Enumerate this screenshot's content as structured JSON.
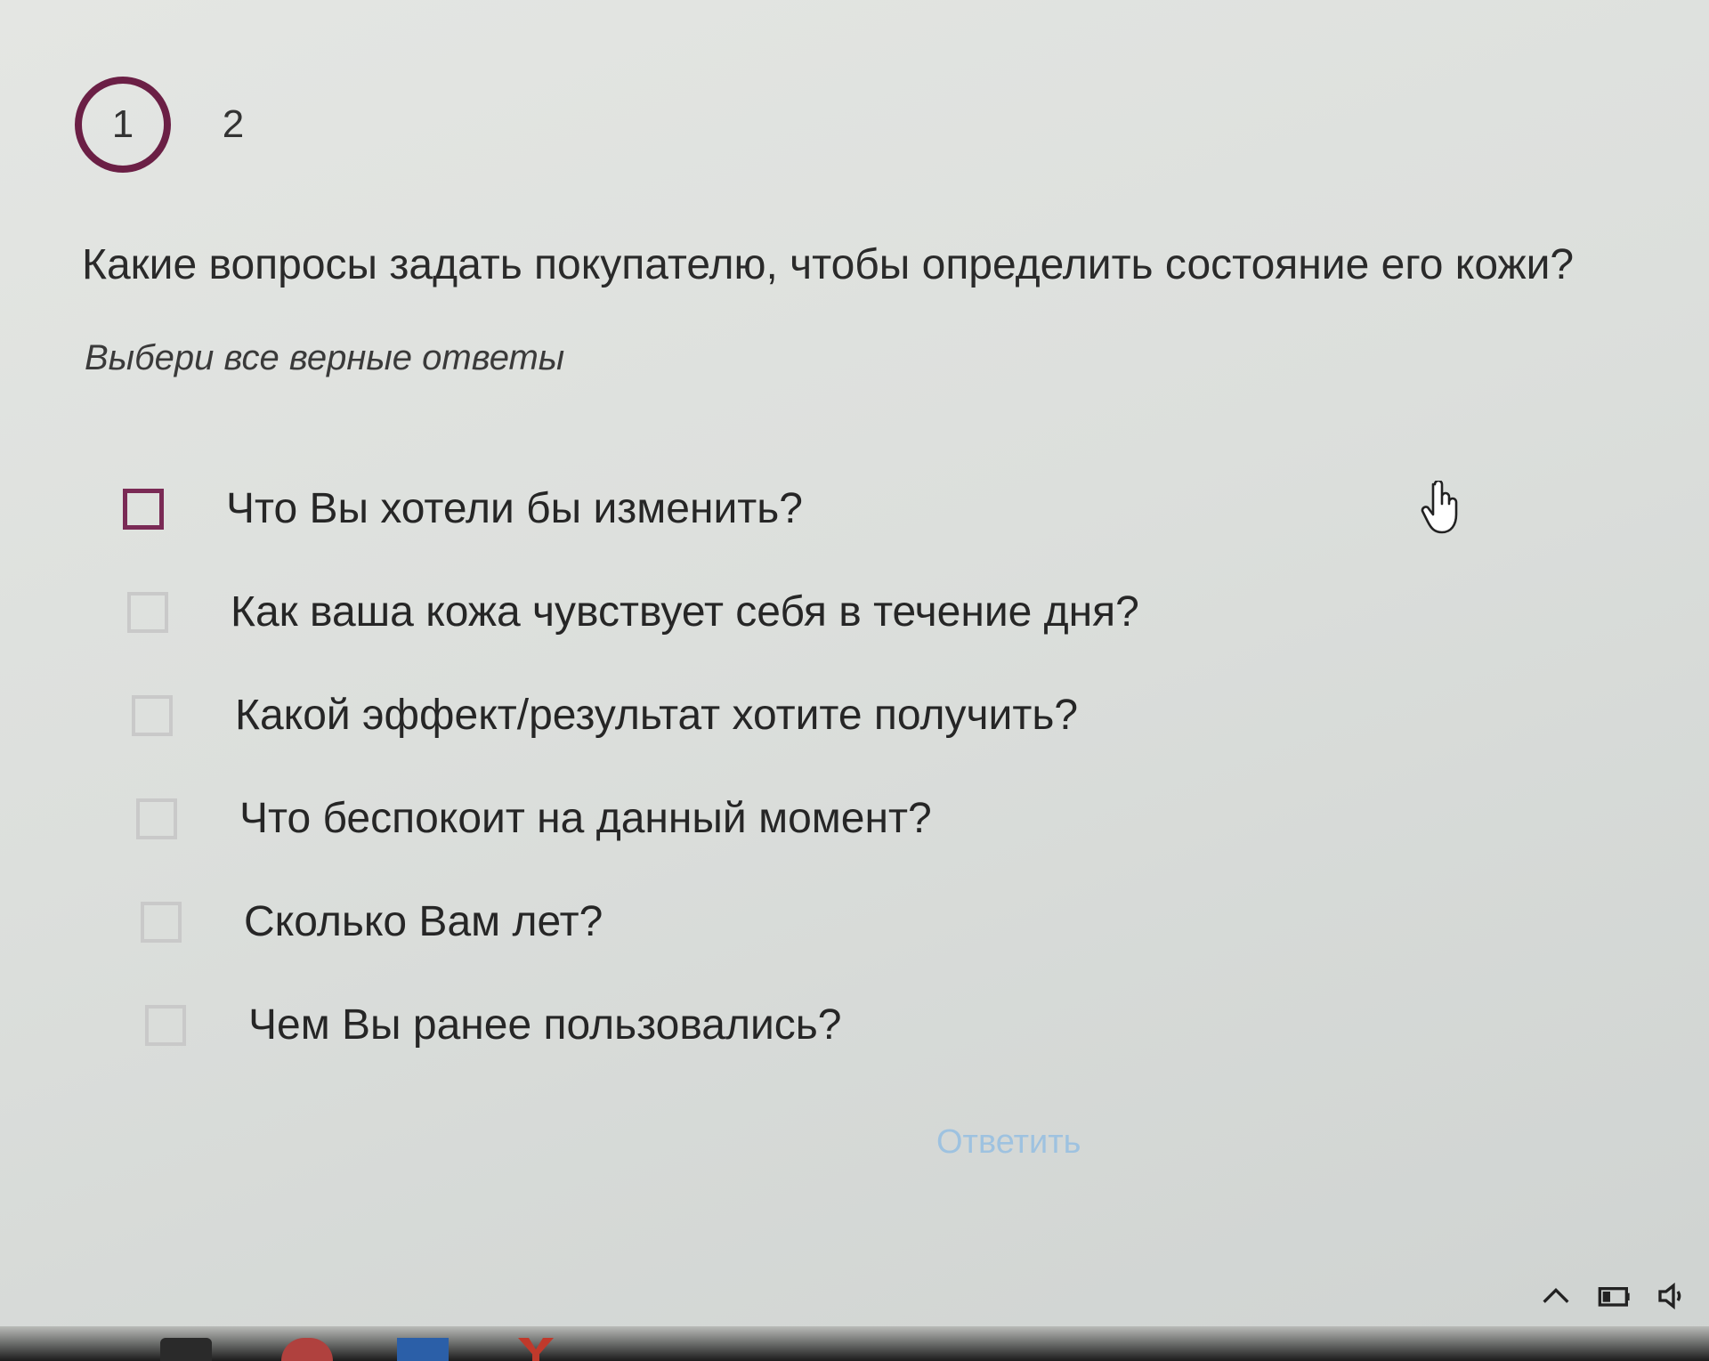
{
  "stepper": {
    "steps": [
      "1",
      "2"
    ],
    "active": "1"
  },
  "question": {
    "text": "Какие вопросы задать покупателю, чтобы определить состояние его кожи?",
    "hint": "Выбери все верные ответы"
  },
  "options": [
    {
      "label": "Что Вы хотели бы изменить?",
      "checked": false
    },
    {
      "label": "Как ваша кожа чувствует себя в течение дня?",
      "checked": false
    },
    {
      "label": "Какой эффект/результат хотите получить?",
      "checked": false
    },
    {
      "label": "Что беспокоит на данный момент?",
      "checked": false
    },
    {
      "label": "Сколько Вам лет?",
      "checked": false
    },
    {
      "label": "Чем Вы ранее пользовались?",
      "checked": false
    }
  ],
  "submit": {
    "label": "Ответить",
    "enabled": false
  },
  "colors": {
    "accent": "#6b1f45",
    "submit_disabled": "#9ec2e0"
  },
  "icons": {
    "cursor": "hand-pointer-icon",
    "tray": [
      "chevron-up-icon",
      "battery-icon",
      "speaker-icon"
    ]
  }
}
